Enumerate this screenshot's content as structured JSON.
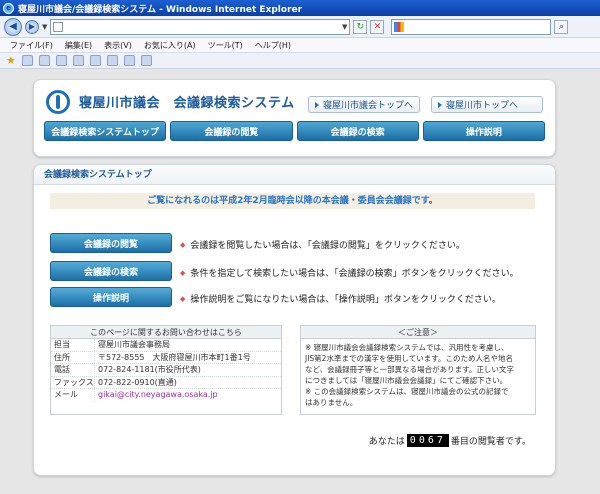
{
  "window": {
    "title": "寝屋川市議会/会議録検索システム - Windows Internet Explorer"
  },
  "address_bar": {
    "url": "",
    "search_value": ""
  },
  "menu": {
    "items": [
      "ファイル(F)",
      "編集(E)",
      "表示(V)",
      "お気に入り(A)",
      "ツール(T)",
      "ヘルプ(H)"
    ]
  },
  "header": {
    "site_title": "寝屋川市議会　会議録検索システム",
    "top_link_council": "寝屋川市議会トップへ",
    "top_link_city": "寝屋川市トップへ",
    "tabs": [
      "会議録検索システムトップ",
      "会議録の閲覧",
      "会議録の検索",
      "操作説明"
    ]
  },
  "main": {
    "heading": "会議録検索システムトップ",
    "notice": "ご覧になれるのは平成2年2月臨時会以降の本会議・委員会会議録です。",
    "actions": [
      {
        "label": "会議録の閲覧",
        "desc": "会議録を閲覧したい場合は、「会議録の閲覧」をクリックください。"
      },
      {
        "label": "会議録の検索",
        "desc": "条件を指定して検索したい場合は、「会議録の検索」ボタンをクリックください。"
      },
      {
        "label": "操作説明",
        "desc": "操作説明をご覧になりたい場合は、「操作説明」ボタンをクリックください。"
      }
    ]
  },
  "contact": {
    "heading": "このページに関するお問い合わせはこちら",
    "rows": [
      {
        "label": "担当",
        "value": "寝屋川市議会事務局"
      },
      {
        "label": "住所",
        "value": "〒572-8555　大阪府寝屋川市本町1番1号"
      },
      {
        "label": "電話",
        "value": "072-824-1181(市役所代表)"
      },
      {
        "label": "ファックス",
        "value": "072-822-0910(直通)"
      },
      {
        "label": "メール",
        "value": "gikai@city.neyagawa.osaka.jp"
      }
    ]
  },
  "caution": {
    "heading": "＜ご注意＞",
    "lines": [
      "※ 寝屋川市議会会議録検索システムでは、汎用性を考慮し、",
      "JIS第2水準までの漢字を使用しています。このため人名や地名",
      "など、会議録冊子等と一部異なる場合があります。正しい文字",
      "につきましては「寝屋川市議会会議録」にてご確認下さい。",
      "※ この会議録検索システムは、寝屋川市議会の公式の記録で",
      "はありません。"
    ]
  },
  "counter": {
    "prefix": "あなたは",
    "digits": "0067",
    "suffix": "番目の閲覧者です。"
  }
}
